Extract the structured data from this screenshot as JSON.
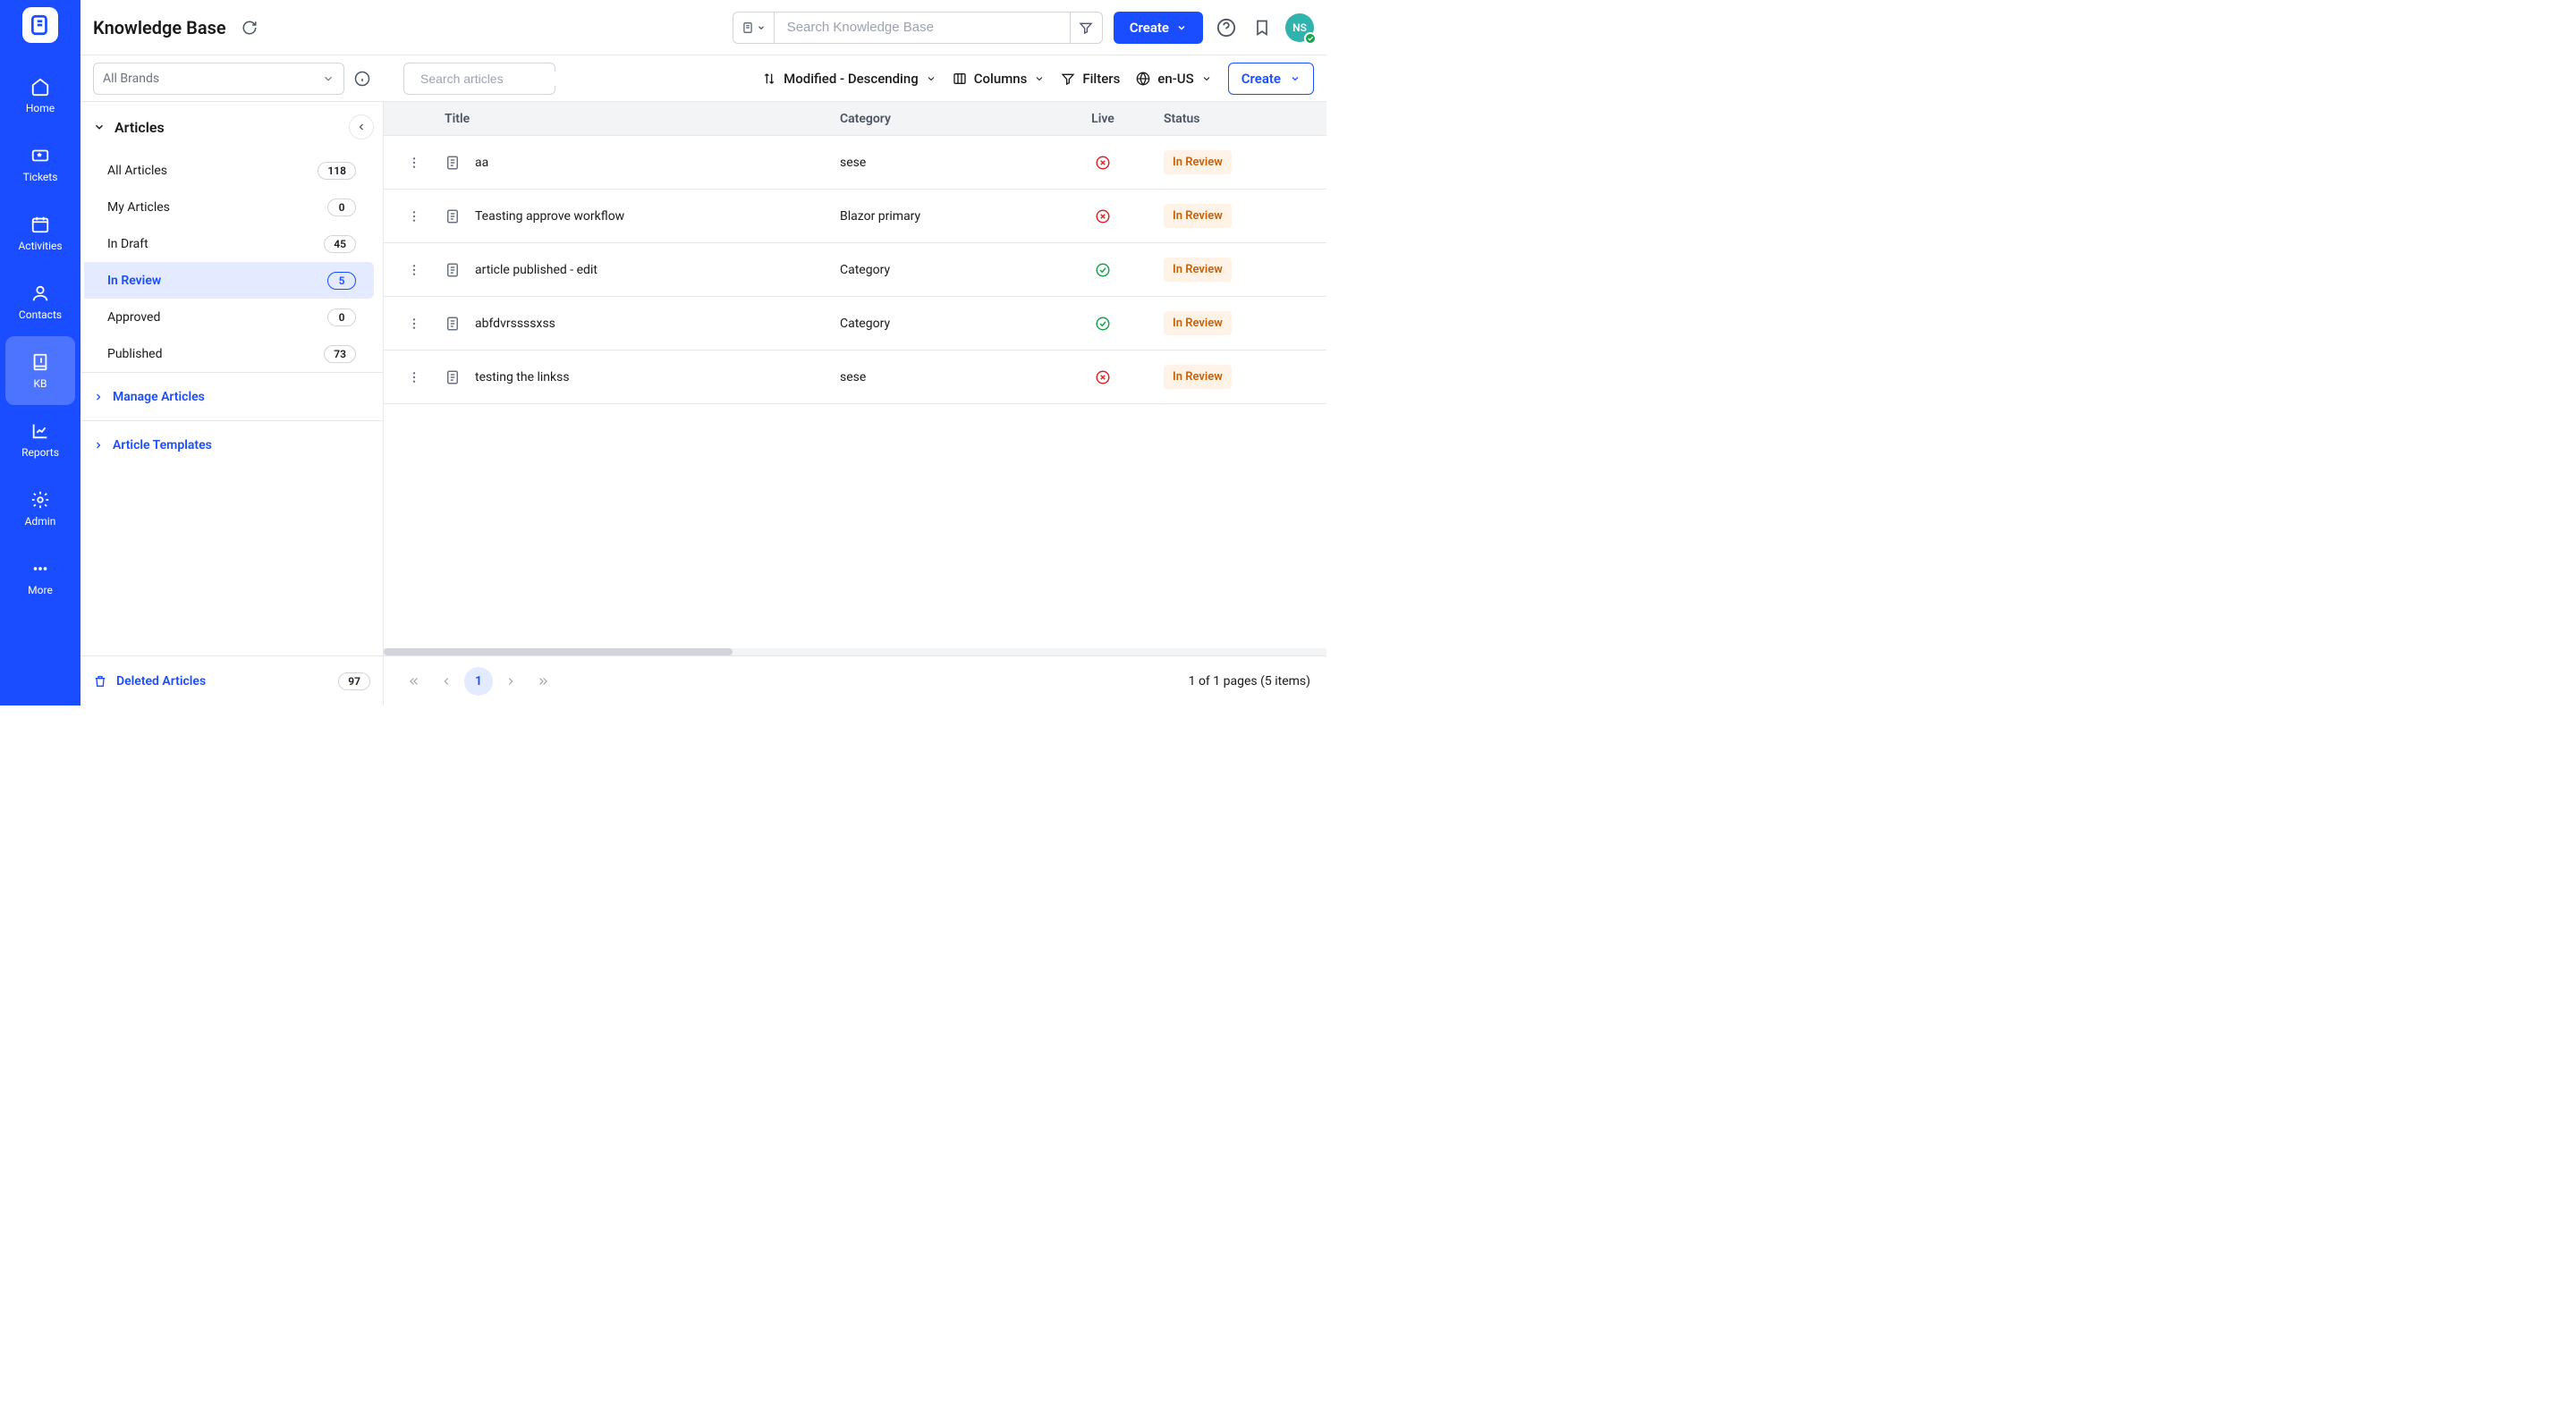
{
  "header": {
    "title": "Knowledge Base",
    "search_placeholder": "Search Knowledge Base",
    "create_label": "Create",
    "avatar_initials": "NS"
  },
  "nav_rail": {
    "items": [
      {
        "label": "Home"
      },
      {
        "label": "Tickets"
      },
      {
        "label": "Activities"
      },
      {
        "label": "Contacts"
      },
      {
        "label": "KB"
      },
      {
        "label": "Reports"
      },
      {
        "label": "Admin"
      },
      {
        "label": "More"
      }
    ]
  },
  "sub_header": {
    "brand_select_label": "All Brands",
    "article_search_placeholder": "Search articles",
    "sort_label": "Modified - Descending",
    "columns_label": "Columns",
    "filters_label": "Filters",
    "locale_label": "en-US",
    "create_label": "Create"
  },
  "sidebar": {
    "section_title": "Articles",
    "items": [
      {
        "label": "All Articles",
        "count": "118"
      },
      {
        "label": "My Articles",
        "count": "0"
      },
      {
        "label": "In Draft",
        "count": "45"
      },
      {
        "label": "In Review",
        "count": "5"
      },
      {
        "label": "Approved",
        "count": "0"
      },
      {
        "label": "Published",
        "count": "73"
      }
    ],
    "manage_label": "Manage Articles",
    "templates_label": "Article Templates",
    "deleted_label": "Deleted Articles",
    "deleted_count": "97"
  },
  "table": {
    "columns": {
      "title": "Title",
      "category": "Category",
      "live": "Live",
      "status": "Status"
    },
    "rows": [
      {
        "title": "aa",
        "category": "sese",
        "live": false,
        "status": "In Review"
      },
      {
        "title": "Teasting approve workflow",
        "category": "Blazor primary",
        "live": false,
        "status": "In Review"
      },
      {
        "title": "article published - edit",
        "category": "Category",
        "live": true,
        "status": "In Review"
      },
      {
        "title": "abfdvrssssxss",
        "category": "Category",
        "live": true,
        "status": "In Review"
      },
      {
        "title": "testing the linkss",
        "category": "sese",
        "live": false,
        "status": "In Review"
      }
    ]
  },
  "pagination": {
    "current_page": "1",
    "info": "1 of 1 pages (5 items)"
  }
}
